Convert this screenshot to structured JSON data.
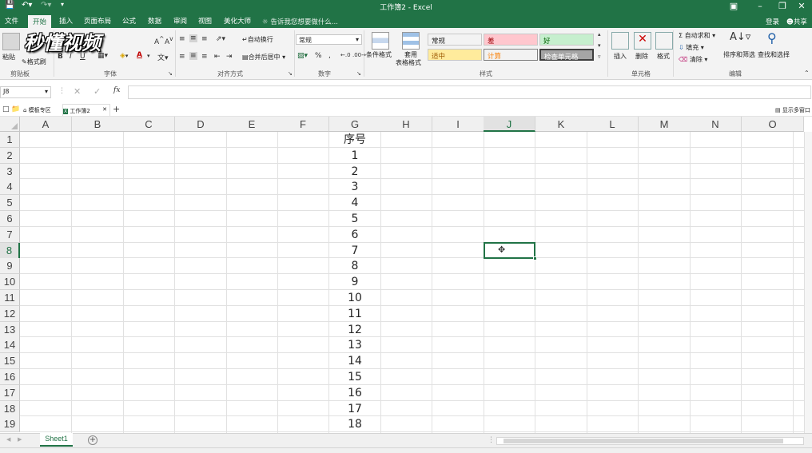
{
  "window": {
    "title": "工作簿2 - Excel",
    "colors": {
      "brand": "#217346",
      "ribbon_bg": "#f3f3f3"
    }
  },
  "menu": {
    "tabs": [
      "文件",
      "开始",
      "插入",
      "页面布局",
      "公式",
      "数据",
      "审阅",
      "视图",
      "美化大师"
    ],
    "active": "开始",
    "tellme": "告诉我您想要做什么...",
    "login": "登录",
    "share": "共享"
  },
  "ribbon": {
    "clipboard": {
      "paste": "粘贴",
      "format_painter": "格式刷",
      "label": "剪贴板"
    },
    "font": {
      "label": "字体",
      "bold": "B",
      "italic": "I",
      "underline": "U"
    },
    "alignment": {
      "wrap": "自动换行",
      "merge": "合并后居中",
      "label": "对齐方式"
    },
    "number": {
      "format": "常规",
      "percent": "%",
      "comma": ",",
      "label": "数字"
    },
    "styles": {
      "conditional": "条件格式",
      "table1": "套用",
      "table2": "表格格式",
      "cells": [
        {
          "text": "常规",
          "bg": "#ffffff",
          "fg": "#262626"
        },
        {
          "text": "差",
          "bg": "#ffc7ce",
          "fg": "#9c0006"
        },
        {
          "text": "好",
          "bg": "#c6efce",
          "fg": "#006100"
        },
        {
          "text": "适中",
          "bg": "#ffeb9c",
          "fg": "#9c5700"
        },
        {
          "text": "计算",
          "bg": "#f2f2f2",
          "fg": "#fa7d00"
        },
        {
          "text": "检查单元格",
          "bg": "#a5a5a5",
          "fg": "#ffffff"
        }
      ],
      "label": "样式"
    },
    "cells_group": {
      "insert": "插入",
      "delete": "删除",
      "format": "格式",
      "label": "单元格"
    },
    "editing": {
      "autosum": "自动求和",
      "fill": "填充",
      "clear": "清除",
      "sort": "排序和筛选",
      "find": "查找和选择",
      "label": "编辑"
    }
  },
  "formula_bar": {
    "name_box": "J8",
    "fx": "fx",
    "value": ""
  },
  "workbook_tabs": {
    "tab1": "模板专区",
    "tab2": "工作簿2",
    "show_multi": "显示多窗口"
  },
  "columns": [
    "A",
    "B",
    "C",
    "D",
    "E",
    "F",
    "G",
    "H",
    "I",
    "J",
    "K",
    "L",
    "M",
    "N",
    "O"
  ],
  "selected_column": "J",
  "selected_row": "8",
  "rows": [
    "1",
    "2",
    "3",
    "4",
    "5",
    "6",
    "7",
    "8",
    "9",
    "10",
    "11",
    "12",
    "13",
    "14",
    "15",
    "16",
    "17",
    "18",
    "19"
  ],
  "column_g_values": [
    "序号",
    "1",
    "2",
    "3",
    "4",
    "5",
    "6",
    "7",
    "8",
    "9",
    "10",
    "11",
    "12",
    "13",
    "14",
    "15",
    "16",
    "17",
    "18"
  ],
  "sheet_tabs": {
    "active": "Sheet1",
    "add": "+"
  },
  "watermark": "秒懂视频"
}
